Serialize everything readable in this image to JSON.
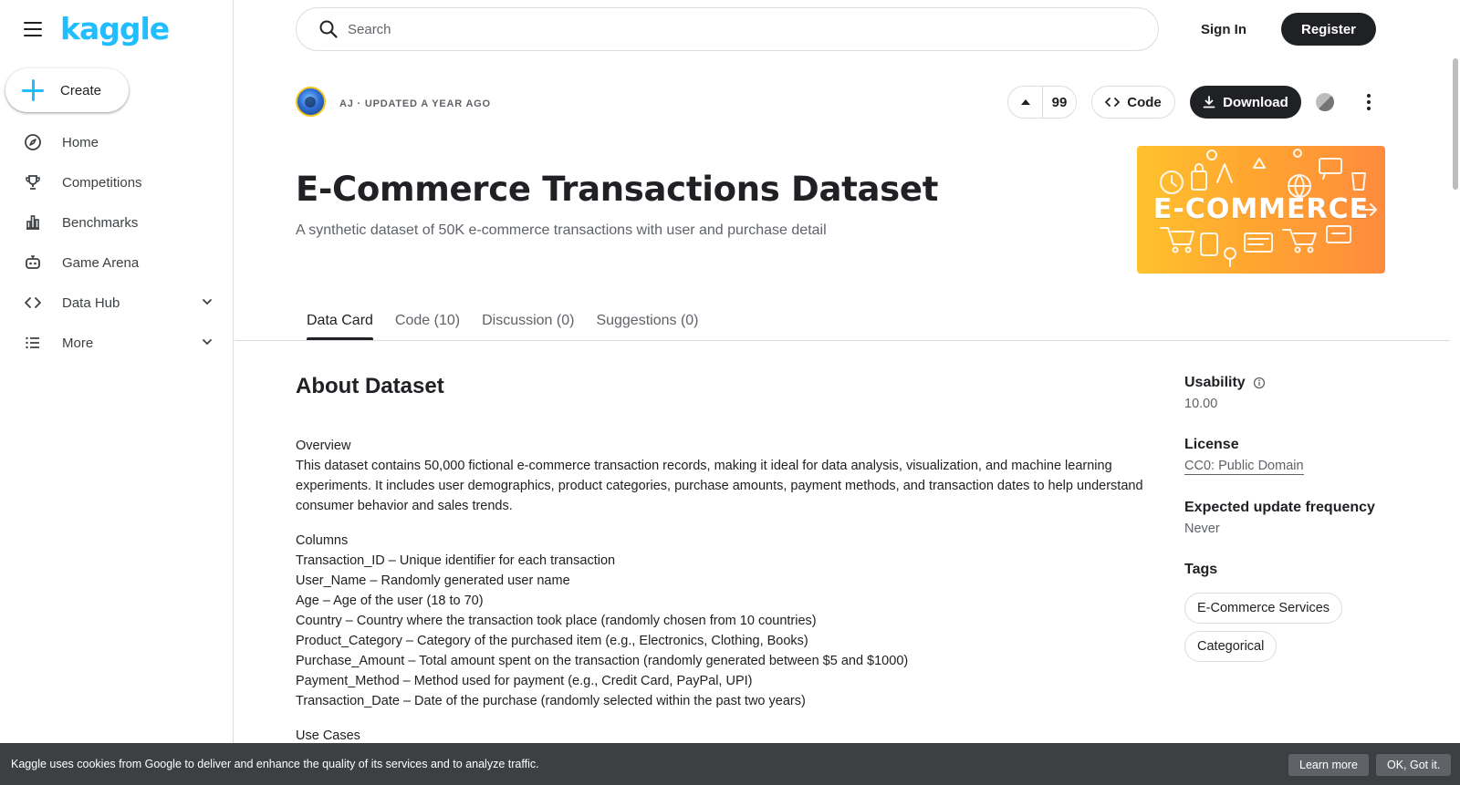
{
  "brand": {
    "logo_text": "kaggle",
    "accent_color": "#20beff"
  },
  "sidebar": {
    "create_label": "Create",
    "items": [
      {
        "label": "Home",
        "icon": "compass-icon"
      },
      {
        "label": "Competitions",
        "icon": "trophy-icon"
      },
      {
        "label": "Benchmarks",
        "icon": "bar-chart-icon"
      },
      {
        "label": "Game Arena",
        "icon": "robot-icon"
      },
      {
        "label": "Data Hub",
        "icon": "code-icon",
        "expandable": true
      },
      {
        "label": "More",
        "icon": "list-icon",
        "expandable": true
      }
    ]
  },
  "header": {
    "search_placeholder": "Search",
    "sign_in": "Sign In",
    "register": "Register"
  },
  "dataset": {
    "author_meta": "AJ · UPDATED A YEAR AGO",
    "vote_count": "99",
    "code_label": "Code",
    "download_label": "Download",
    "title": "E-Commerce Transactions Dataset",
    "subtitle": "A synthetic dataset of 50K e-commerce transactions with user and purchase detail",
    "banner_text": "E-COMMERCE"
  },
  "tabs": [
    {
      "label": "Data Card",
      "active": true
    },
    {
      "label": "Code (10)",
      "active": false
    },
    {
      "label": "Discussion (0)",
      "active": false
    },
    {
      "label": "Suggestions (0)",
      "active": false
    }
  ],
  "about": {
    "heading": "About Dataset",
    "overview_title": "Overview",
    "overview_text": "This dataset contains 50,000 fictional e-commerce transaction records, making it ideal for data analysis, visualization, and machine learning experiments. It includes user demographics, product categories, purchase amounts, payment methods, and transaction dates to help understand consumer behavior and sales trends.",
    "columns_title": "Columns",
    "columns": [
      "Transaction_ID – Unique identifier for each transaction",
      "User_Name – Randomly generated user name",
      "Age – Age of the user (18 to 70)",
      "Country – Country where the transaction took place (randomly chosen from 10 countries)",
      "Product_Category – Category of the purchased item (e.g., Electronics, Clothing, Books)",
      "Purchase_Amount – Total amount spent on the transaction (randomly generated between $5 and $1000)",
      "Payment_Method – Method used for payment (e.g., Credit Card, PayPal, UPI)",
      "Transaction_Date – Date of the purchase (randomly selected within the past two years)"
    ],
    "use_cases_title": "Use Cases"
  },
  "meta_panel": {
    "usability_label": "Usability",
    "usability_value": "10.00",
    "license_label": "License",
    "license_value": "CC0: Public Domain",
    "frequency_label": "Expected update frequency",
    "frequency_value": "Never",
    "tags_label": "Tags",
    "tags": [
      "E-Commerce Services",
      "Categorical"
    ]
  },
  "cookie_bar": {
    "text": "Kaggle uses cookies from Google to deliver and enhance the quality of its services and to analyze traffic.",
    "learn_more": "Learn more",
    "ok": "OK, Got it."
  }
}
